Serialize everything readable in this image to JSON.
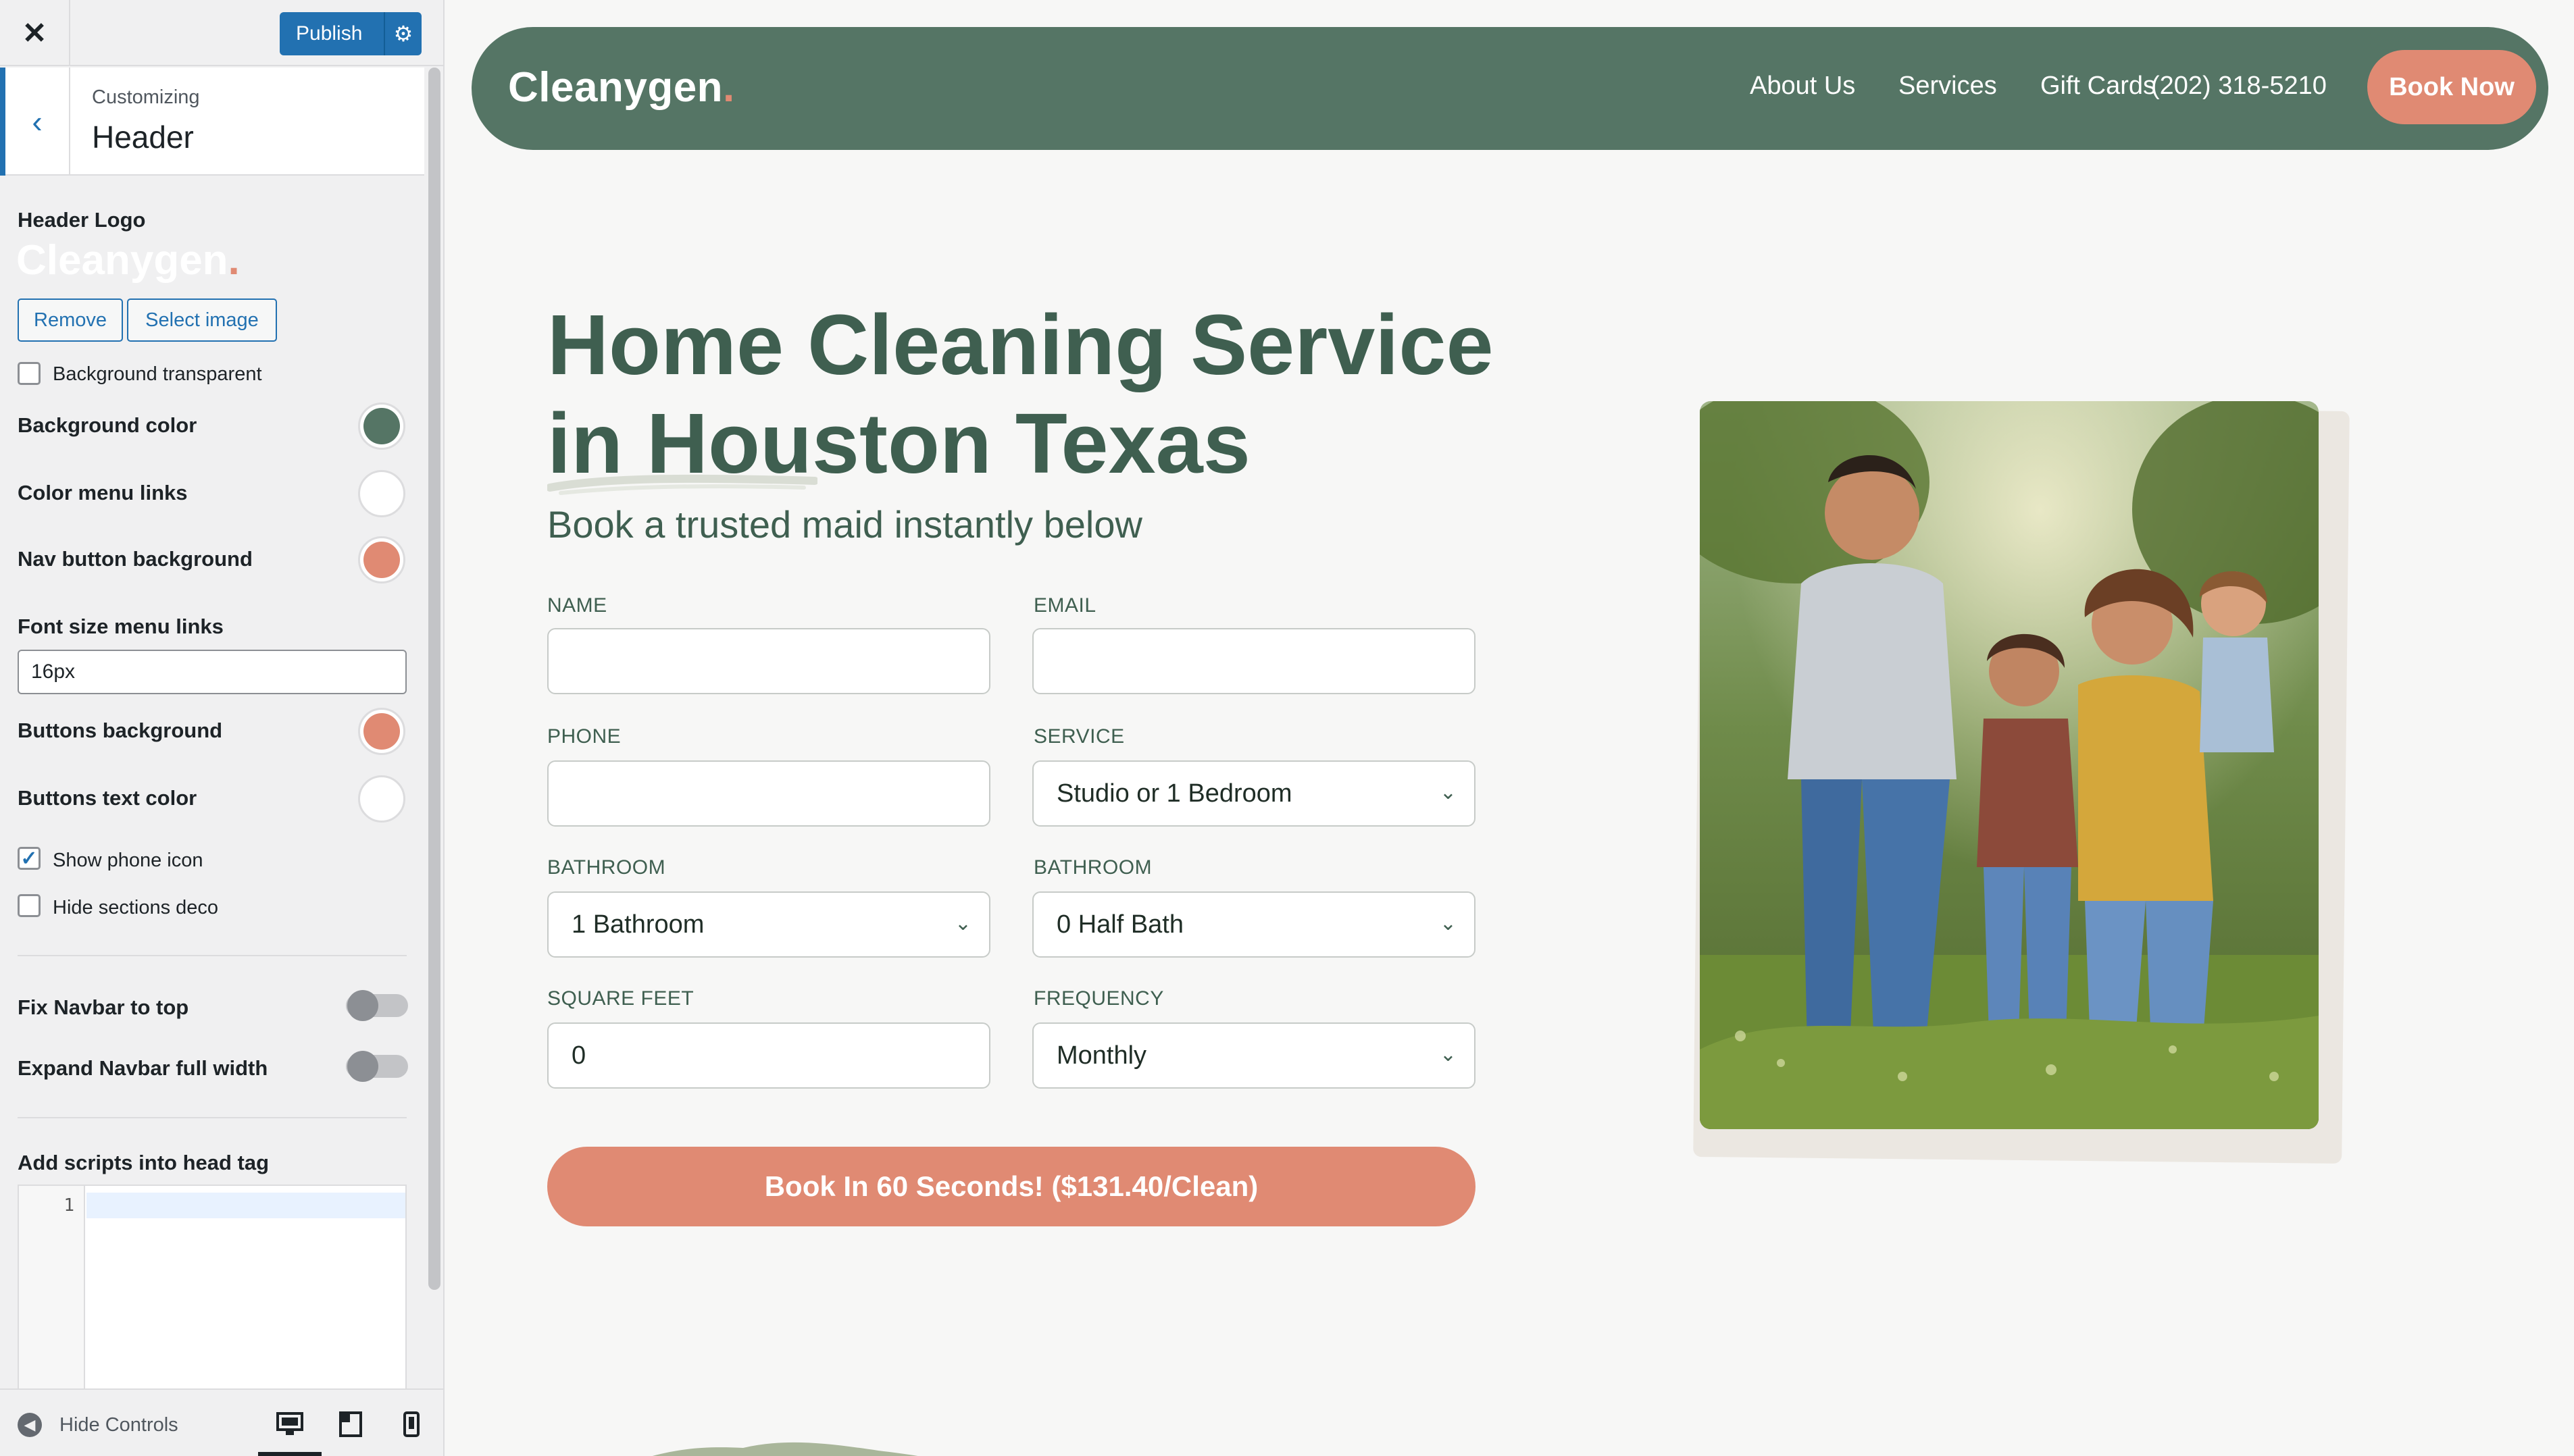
{
  "customizer": {
    "publish_label": "Publish",
    "section": {
      "small": "Customizing",
      "title": "Header"
    },
    "header_logo_label": "Header Logo",
    "logo_preview": {
      "text": "Cleanygen",
      "dot": "."
    },
    "remove_label": "Remove",
    "select_image_label": "Select image",
    "bg_transparent": {
      "label": "Background transparent",
      "checked": false
    },
    "background_color": {
      "label": "Background color",
      "value": "#557565"
    },
    "menu_links_color": {
      "label": "Color menu links",
      "value": "#ffffff"
    },
    "nav_button_bg": {
      "label": "Nav button background",
      "value": "#e08a73"
    },
    "font_size": {
      "label": "Font size menu links",
      "value": "16px"
    },
    "buttons_bg": {
      "label": "Buttons background",
      "value": "#e08a73"
    },
    "buttons_text_color": {
      "label": "Buttons text color",
      "value": "#ffffff"
    },
    "show_phone_icon": {
      "label": "Show phone icon",
      "checked": true
    },
    "hide_sections_deco": {
      "label": "Hide sections deco",
      "checked": false
    },
    "fix_navbar": {
      "label": "Fix Navbar to top",
      "on": false
    },
    "expand_navbar": {
      "label": "Expand Navbar full width",
      "on": false
    },
    "scripts_head": {
      "label": "Add scripts into head tag",
      "line_number": "1"
    },
    "hide_controls_label": "Hide Controls",
    "devices": [
      "desktop-icon",
      "tablet-icon",
      "mobile-icon"
    ]
  },
  "site": {
    "logo": {
      "text": "Cleanygen",
      "dot": "."
    },
    "nav": [
      "About Us",
      "Services",
      "Gift Cards"
    ],
    "phone": "(202) 318-5210",
    "book_now": "Book Now",
    "hero": {
      "title_line1": "Home Cleaning Service",
      "title_line2": "in Houston Texas",
      "subtitle": "Book a trusted maid instantly below"
    },
    "form": {
      "name_label": "NAME",
      "email_label": "EMAIL",
      "phone_label": "PHONE",
      "service_label": "SERVICE",
      "service_value": "Studio or 1 Bedroom",
      "bathroom_label": "BATHROOM",
      "bathroom_value": "1 Bathroom",
      "half_bath_label": "BATHROOM",
      "half_bath_value": "0 Half Bath",
      "sqft_label": "SQUARE FEET",
      "sqft_value": "0",
      "frequency_label": "FREQUENCY",
      "frequency_value": "Monthly",
      "submit": "Book In 60 Seconds! ($131.40/Clean)"
    },
    "colors": {
      "brand_green": "#557565",
      "heading_green": "#3f5f50",
      "accent": "#e08a73"
    }
  }
}
